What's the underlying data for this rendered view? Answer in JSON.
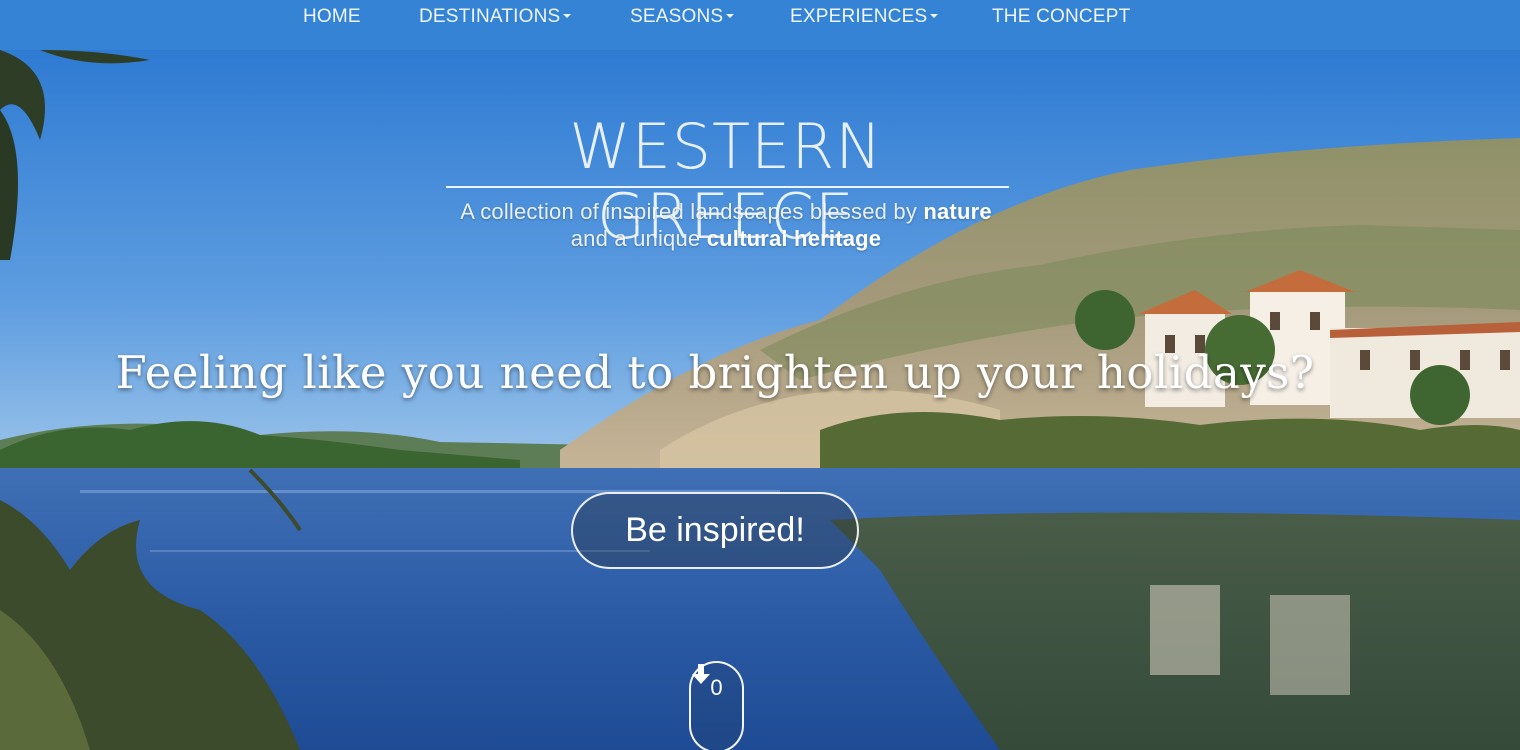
{
  "nav": {
    "items": [
      {
        "label": "HOME",
        "dropdown": false
      },
      {
        "label": "DESTINATIONS",
        "dropdown": true
      },
      {
        "label": "SEASONS",
        "dropdown": true
      },
      {
        "label": "EXPERIENCES",
        "dropdown": true
      },
      {
        "label": "THE CONCEPT",
        "dropdown": false
      }
    ]
  },
  "hero": {
    "title": "WESTERN GREECE",
    "tagline_1": "A collection of inspired landscapes blessed by",
    "tagline_1_bold": "nature",
    "tagline_2": "and a unique",
    "tagline_2_bold": "cultural heritage",
    "headline": "Feeling like you need to brighten up your holidays?",
    "cta_label": "Be inspired!",
    "scroll_count": "0",
    "scroll_icon": "arrow-down-icon"
  },
  "colors": {
    "navbar": "#3583d4",
    "sky": "#3f86d6",
    "lake": "#2a5fa8",
    "text": "#ffffff"
  }
}
